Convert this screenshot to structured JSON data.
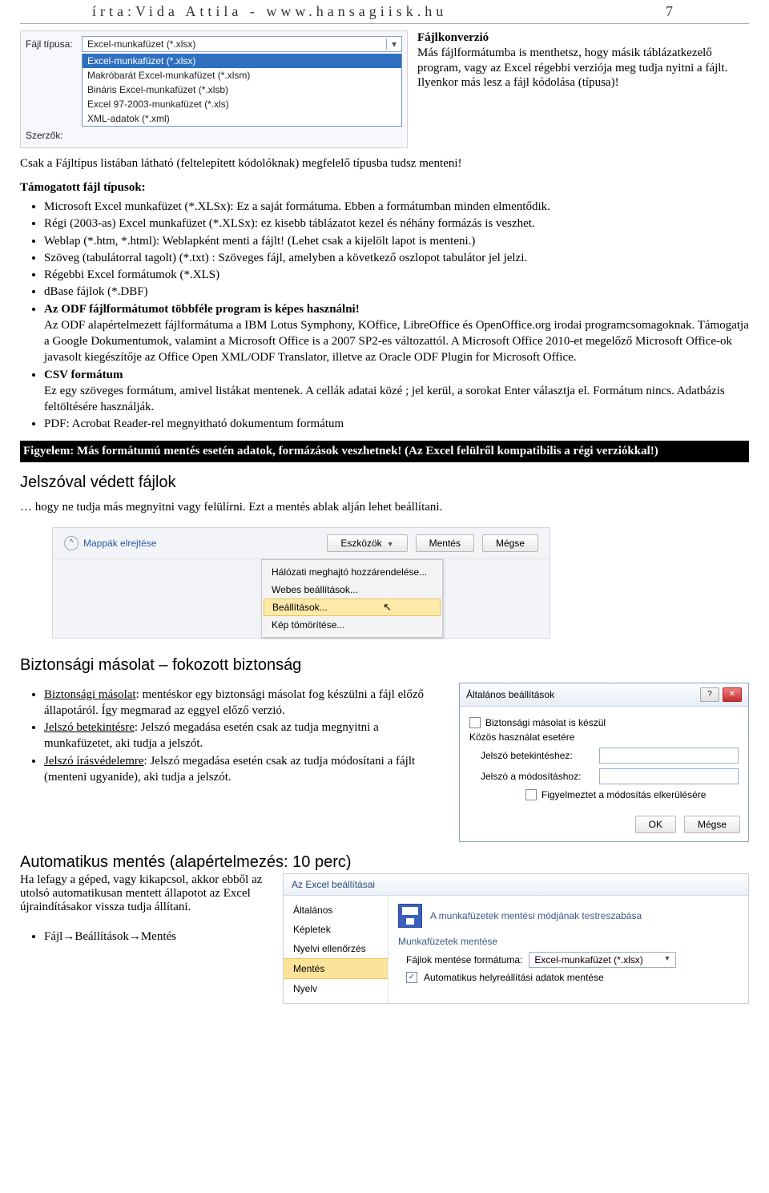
{
  "header": {
    "left": "írta:Vida Attila - www.hansagiisk.hu",
    "page": "7"
  },
  "dropdown": {
    "label_type": "Fájl típusa:",
    "label_author": "Szerzők:",
    "value": "Excel-munkafüzet (*.xlsx)",
    "items": [
      "Excel-munkafüzet (*.xlsx)",
      "Makróbarát Excel-munkafüzet (*.xlsm)",
      "Bináris Excel-munkafüzet (*.xlsb)",
      "Excel 97-2003-munkafüzet (*.xls)",
      "XML-adatok (*.xml)"
    ]
  },
  "side": {
    "title": "Fájlkonverzió",
    "text": "Más fájlformátumba is menthetsz, hogy másik táblázatkezelő program, vagy az Excel régebbi verziója meg tudja nyitni a fájlt. Ilyenkor más lesz a fájl kódolása (típusa)!"
  },
  "para1": "Csak a Fájltípus listában látható (feltelepített kódolóknak) megfelelő típusba tudsz menteni!",
  "supported_title": "Támogatott fájl típusok:",
  "supported": [
    "Microsoft Excel munkafüzet (*.XLSx): Ez a saját formátuma. Ebben a formátumban minden elmentődik.",
    "Régi (2003-as) Excel munkafüzet (*.XLSx): ez kisebb táblázatot kezel és néhány formázás is veszhet.",
    "Weblap (*.htm, *.html): Weblapként menti a fájlt! (Lehet csak a kijelölt lapot is menteni.)",
    "Szöveg (tabulátorral tagolt) (*.txt) : Szöveges fájl, amelyben a következő oszlopot tabulátor jel jelzi.",
    "Régebbi Excel formátumok (*.XLS)",
    "dBase fájlok (*.DBF)"
  ],
  "odf_title": "Az ODF fájlformátumot többféle program is képes használni!",
  "odf_text": "Az ODF alapértelmezett fájlformátuma a IBM Lotus Symphony, KOffice, LibreOffice és OpenOffice.org irodai programcsomagoknak. Támogatja a Google Dokumentumok, valamint a Microsoft Office is a 2007 SP2-es változattól. A Microsoft Office 2010-et megelőző Microsoft Office-ok javasolt kiegészítője az Office Open XML/ODF Translator, illetve az Oracle ODF Plugin for Microsoft Office.",
  "csv_title": "CSV formátum",
  "csv_text": "Ez egy szöveges formátum, amivel listákat mentenek. A cellák adatai közé ; jel kerül, a sorokat Enter választja el. Formátum nincs. Adatbázis feltöltésére használják.",
  "pdf_text": "PDF: Acrobat Reader-rel megnyitható dokumentum formátum",
  "warn": "Figyelem: Más formátumú mentés esetén adatok, formázások veszhetnek! (Az Excel  felülről kompatibilis a régi verziókkal!)",
  "h_pw": "Jelszóval védett fájlok",
  "pw_text": "… hogy ne tudja más megnyitni vagy felülírni. Ezt a mentés ablak alján lehet beállítani.",
  "menu": {
    "hide": "Mappák elrejtése",
    "tools": "Eszközök",
    "save": "Mentés",
    "cancel": "Mégse",
    "items": [
      "Hálózati meghajtó hozzárendelése...",
      "Webes beállítások...",
      "Beállítások...",
      "Kép tömörítése..."
    ]
  },
  "h_sec": "Biztonsági másolat – fokozott biztonság",
  "sec": [
    {
      "u": "Biztonsági másolat",
      "t": ": mentéskor egy biztonsági másolat fog készülni a fájl előző állapotáról. Így megmarad az eggyel előző verzió."
    },
    {
      "u": "Jelszó betekintésre",
      "t": ": Jelszó megadása esetén csak az tudja megnyitni a munkafüzetet, aki tudja a jelszót."
    },
    {
      "u": "Jelszó írásvédelemre",
      "t": ": Jelszó megadása esetén csak az tudja módosítani a fájlt (menteni ugyanide), aki tudja a jelszót."
    }
  ],
  "dlg": {
    "title": "Általános beállítások",
    "chk1": "Biztonsági másolat is készül",
    "share": "Közös használat esetére",
    "pw1": "Jelszó betekintéshez:",
    "pw2": "Jelszó a módosításhoz:",
    "chk2": "Figyelmeztet a módosítás elkerülésére",
    "ok": "OK",
    "cancel": "Mégse"
  },
  "h_auto": "Automatikus mentés (alapértelmezés: 10 perc)",
  "auto_text": "Ha lefagy a géped, vagy kikapcsol, akkor ebből az utolsó automatikusan mentett állapotot az Excel újraindításakor vissza tudja állítani.",
  "auto_path": "Fájl→Beállítások→Mentés",
  "opt": {
    "title": "Az Excel beállításai",
    "side": [
      "Általános",
      "Képletek",
      "Nyelvi ellenőrzés",
      "Mentés",
      "Nyelv"
    ],
    "head": "A munkafüzetek mentési módjának testreszabása",
    "sec": "Munkafüzetek mentése",
    "fmt_label": "Fájlok mentése formátuma:",
    "fmt_value": "Excel-munkafüzet (*.xlsx)",
    "auto_chk": "Automatikus helyreállítási adatok mentése"
  }
}
